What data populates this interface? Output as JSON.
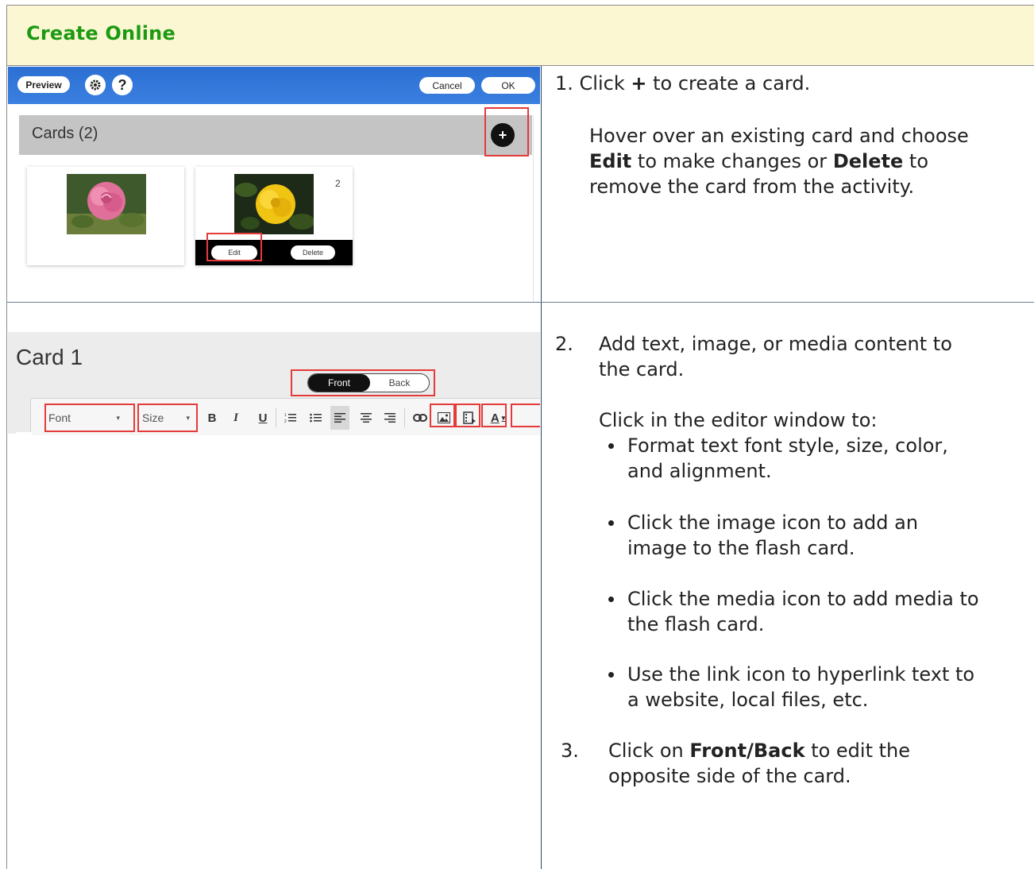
{
  "header": {
    "title": "Create Online"
  },
  "shot1": {
    "preview_label": "Preview",
    "gear_icon": "gear-icon",
    "help_label": "?",
    "cancel_label": "Cancel",
    "ok_label": "OK",
    "cards_label": "Cards (2)",
    "add_label": "+",
    "card2_number": "2",
    "edit_label": "Edit",
    "delete_label": "Delete"
  },
  "shot2": {
    "card_title": "Card 1",
    "front_label": "Front",
    "back_label": "Back",
    "font_label": "Font",
    "size_label": "Size",
    "bold_label": "B",
    "italic_label": "I",
    "underline_label": "U",
    "color_label": "A"
  },
  "steps": {
    "s1_num": "1.",
    "s1_pre": "Click",
    "s1_plus": "+",
    "s1_post": "to create a card.",
    "s1b_line1": "Hover over an existing card and choose",
    "s1b_edit": "Edit",
    "s1b_mid": "to make changes or",
    "s1b_delete": "Delete",
    "s1b_to": "to",
    "s1b_line3": "remove the card from the activity.",
    "s2_num": "2.",
    "s2_line1": "Add text, image, or media content to",
    "s2_line2": "the card.",
    "s2_intro": "Click in the editor window to:",
    "b1_line1": "Format text font style, size, color,",
    "b1_line2": "and alignment.",
    "b2_line1": "Click the image icon to add an",
    "b2_line2": "image to the flash card.",
    "b3_line1": "Click the media icon to add media to",
    "b3_line2": "the flash card.",
    "b4_line1": "Use the link icon to hyperlink text to",
    "b4_line2": "a website, local files, etc.",
    "s3_num": "3.",
    "s3_pre": "Click on",
    "s3_bold": "Front/Back",
    "s3_post": "to edit the",
    "s3_line2": "opposite side of the card."
  },
  "colors": {
    "header_bg": "#fbf7d3",
    "header_text": "#1c9a12",
    "topbar_blue": "#2f73d6",
    "highlight_red": "#e53a3a"
  }
}
